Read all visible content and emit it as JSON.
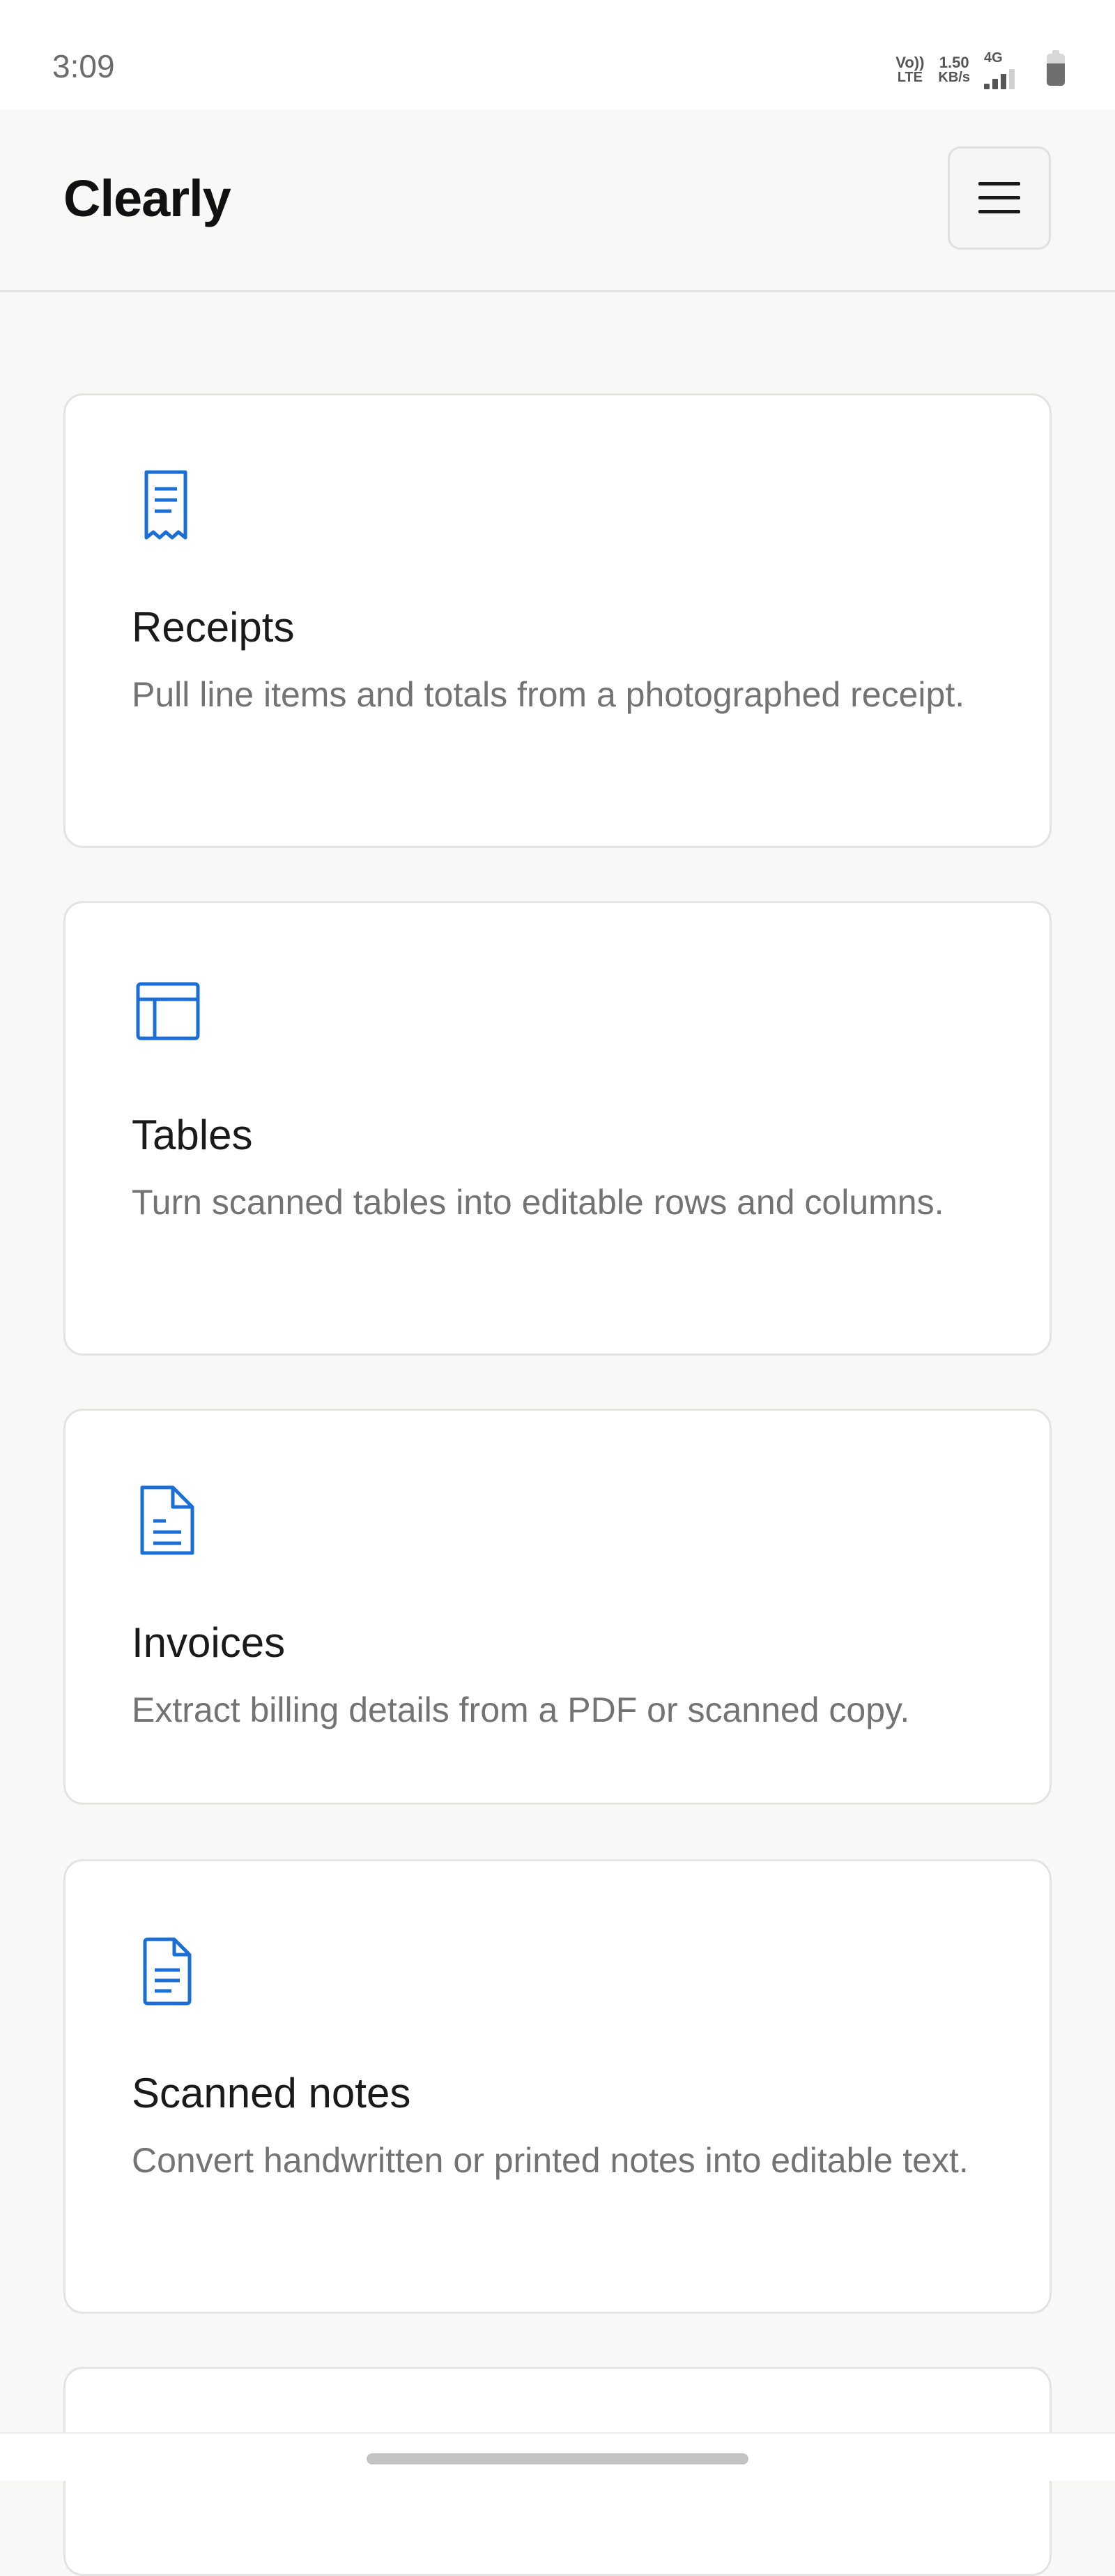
{
  "status": {
    "time": "3:09",
    "volte_top": "Vo))",
    "volte_bottom": "LTE",
    "speed_value": "1.50",
    "speed_unit": "KB/s",
    "network_type": "4G",
    "signal_level": 0.75,
    "battery_level": 0.7
  },
  "header": {
    "title": "Clearly",
    "menu_icon": "hamburger-menu-icon"
  },
  "cards": [
    {
      "icon": "receipt-icon",
      "title": "Receipts",
      "description": "Pull line items and totals from a photographed receipt."
    },
    {
      "icon": "table-icon",
      "title": "Tables",
      "description": "Turn scanned tables into editable rows and columns."
    },
    {
      "icon": "document-icon",
      "title": "Invoices",
      "description": "Extract billing details from a PDF or scanned copy."
    },
    {
      "icon": "notes-icon",
      "title": "Scanned notes",
      "description": "Convert handwritten or printed notes into editable text."
    }
  ],
  "colors": {
    "accent": "#1a6fd6",
    "background": "#f8f8f7",
    "card": "#ffffff",
    "title_text": "#1a1a1a",
    "body_text": "#737373"
  }
}
